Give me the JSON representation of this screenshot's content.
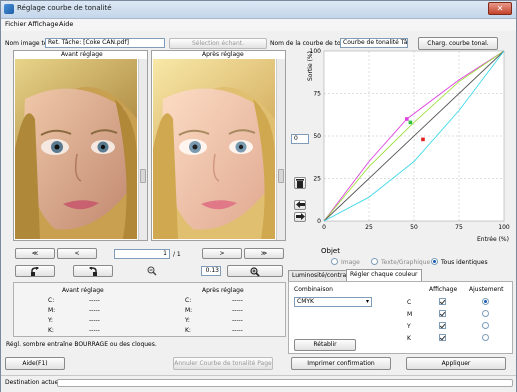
{
  "window": {
    "title": "Réglage courbe de tonalité",
    "close": "✕"
  },
  "menu": {
    "items": [
      "Fichier",
      "Affichage",
      "Aide"
    ]
  },
  "top": {
    "image_label": "Nom image test",
    "image_value": "Ret. Tâche: [Coke CAN.pdf]",
    "sample_button": "Sélection échant.",
    "curve_name_label": "Nom de la courbe de tonalité",
    "curve_name_value": "Courbe de tonalité Tâche",
    "load_button": "Charg. courbe tonal."
  },
  "preview": {
    "before_title": "Avant réglage",
    "after_title": "Après réglage"
  },
  "nav": {
    "first": "≪",
    "prev": "<",
    "page": "1",
    "page_total": "/ 1",
    "next": ">",
    "last": "≫",
    "zoom_value": "0.13"
  },
  "values_table": {
    "before_header": "Avant réglage",
    "after_header": "Après réglage",
    "channels": [
      "C:",
      "M:",
      "Y:",
      "K:"
    ],
    "before": [
      "-----",
      "-----",
      "-----",
      "-----"
    ],
    "after": [
      "-----",
      "-----",
      "-----",
      "-----"
    ]
  },
  "hint": "Régl. sombre entraîne BOURRAGE ou des cloques.",
  "buttons": {
    "help": "Aide(F1)",
    "cancel_curve": "Annuler Courbe de tonalité Page",
    "print_confirm": "Imprimer confirmation",
    "apply": "Appliquer",
    "reset": "Rétablir"
  },
  "graph": {
    "y_label": "Sortie (%)",
    "x_label": "Entrée (%)",
    "ticks": [
      "0",
      "25",
      "50",
      "75",
      "100"
    ],
    "spin_value": "0"
  },
  "object": {
    "title": "Objet",
    "options": [
      "Image",
      "Texte/Graphique",
      "Tous identiques"
    ],
    "selected": "Tous identiques"
  },
  "tabs": [
    "Luminosité/contraste",
    "Régler chaque couleur"
  ],
  "color_panel": {
    "combination_label": "Combinaison",
    "combination_value": "CMYK",
    "display_header": "Affichage",
    "adjust_header": "Ajustement",
    "channels": [
      "C",
      "M",
      "Y",
      "K"
    ]
  },
  "status": {
    "text": "Destination actuelle"
  },
  "chart_data": {
    "type": "line",
    "xlabel": "Entrée (%)",
    "ylabel": "Sortie (%)",
    "xlim": [
      0,
      100
    ],
    "ylim": [
      0,
      100
    ],
    "grid": true,
    "series": [
      {
        "color": "#e040e0",
        "x": [
          0,
          25,
          46,
          75,
          100
        ],
        "y": [
          0,
          35,
          60,
          83,
          100
        ]
      },
      {
        "color": "#a0e040",
        "x": [
          0,
          25,
          50,
          75,
          100
        ],
        "y": [
          0,
          32,
          58,
          82,
          100
        ]
      },
      {
        "color": "#555555",
        "x": [
          0,
          100
        ],
        "y": [
          0,
          100
        ]
      },
      {
        "color": "#40d8e8",
        "x": [
          0,
          25,
          50,
          75,
          100
        ],
        "y": [
          0,
          14,
          35,
          65,
          100
        ]
      }
    ],
    "points": [
      {
        "color": "#e040e0",
        "x": 46,
        "y": 60
      },
      {
        "color": "#30c040",
        "x": 48,
        "y": 58
      },
      {
        "color": "#e02020",
        "x": 55,
        "y": 48
      }
    ]
  }
}
